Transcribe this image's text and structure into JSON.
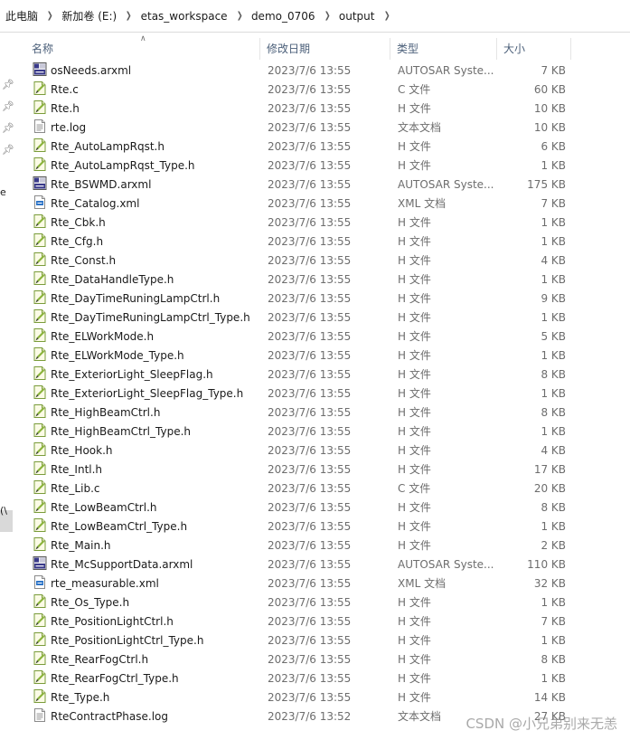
{
  "breadcrumb": [
    "此电脑",
    "新加卷 (E:)",
    "etas_workspace",
    "demo_0706",
    "output"
  ],
  "columns": {
    "name": "名称",
    "date": "修改日期",
    "type": "类型",
    "size": "大小"
  },
  "nav_fragments": [
    "e",
    "(\\"
  ],
  "files": [
    {
      "name": "osNeeds.arxml",
      "date": "2023/7/6 13:55",
      "type": "AUTOSAR Syste...",
      "size": "7 KB",
      "icon": "arxml-file-icon"
    },
    {
      "name": "Rte.c",
      "date": "2023/7/6 13:55",
      "type": "C 文件",
      "size": "60 KB",
      "icon": "source-file-icon"
    },
    {
      "name": "Rte.h",
      "date": "2023/7/6 13:55",
      "type": "H 文件",
      "size": "10 KB",
      "icon": "source-file-icon"
    },
    {
      "name": "rte.log",
      "date": "2023/7/6 13:55",
      "type": "文本文档",
      "size": "10 KB",
      "icon": "text-file-icon"
    },
    {
      "name": "Rte_AutoLampRqst.h",
      "date": "2023/7/6 13:55",
      "type": "H 文件",
      "size": "6 KB",
      "icon": "source-file-icon"
    },
    {
      "name": "Rte_AutoLampRqst_Type.h",
      "date": "2023/7/6 13:55",
      "type": "H 文件",
      "size": "1 KB",
      "icon": "source-file-icon"
    },
    {
      "name": "Rte_BSWMD.arxml",
      "date": "2023/7/6 13:55",
      "type": "AUTOSAR Syste...",
      "size": "175 KB",
      "icon": "arxml-file-icon"
    },
    {
      "name": "Rte_Catalog.xml",
      "date": "2023/7/6 13:55",
      "type": "XML 文档",
      "size": "7 KB",
      "icon": "xml-file-icon"
    },
    {
      "name": "Rte_Cbk.h",
      "date": "2023/7/6 13:55",
      "type": "H 文件",
      "size": "1 KB",
      "icon": "source-file-icon"
    },
    {
      "name": "Rte_Cfg.h",
      "date": "2023/7/6 13:55",
      "type": "H 文件",
      "size": "1 KB",
      "icon": "source-file-icon"
    },
    {
      "name": "Rte_Const.h",
      "date": "2023/7/6 13:55",
      "type": "H 文件",
      "size": "4 KB",
      "icon": "source-file-icon"
    },
    {
      "name": "Rte_DataHandleType.h",
      "date": "2023/7/6 13:55",
      "type": "H 文件",
      "size": "1 KB",
      "icon": "source-file-icon"
    },
    {
      "name": "Rte_DayTimeRuningLampCtrl.h",
      "date": "2023/7/6 13:55",
      "type": "H 文件",
      "size": "9 KB",
      "icon": "source-file-icon"
    },
    {
      "name": "Rte_DayTimeRuningLampCtrl_Type.h",
      "date": "2023/7/6 13:55",
      "type": "H 文件",
      "size": "1 KB",
      "icon": "source-file-icon"
    },
    {
      "name": "Rte_ELWorkMode.h",
      "date": "2023/7/6 13:55",
      "type": "H 文件",
      "size": "5 KB",
      "icon": "source-file-icon"
    },
    {
      "name": "Rte_ELWorkMode_Type.h",
      "date": "2023/7/6 13:55",
      "type": "H 文件",
      "size": "1 KB",
      "icon": "source-file-icon"
    },
    {
      "name": "Rte_ExteriorLight_SleepFlag.h",
      "date": "2023/7/6 13:55",
      "type": "H 文件",
      "size": "8 KB",
      "icon": "source-file-icon"
    },
    {
      "name": "Rte_ExteriorLight_SleepFlag_Type.h",
      "date": "2023/7/6 13:55",
      "type": "H 文件",
      "size": "1 KB",
      "icon": "source-file-icon"
    },
    {
      "name": "Rte_HighBeamCtrl.h",
      "date": "2023/7/6 13:55",
      "type": "H 文件",
      "size": "8 KB",
      "icon": "source-file-icon"
    },
    {
      "name": "Rte_HighBeamCtrl_Type.h",
      "date": "2023/7/6 13:55",
      "type": "H 文件",
      "size": "1 KB",
      "icon": "source-file-icon"
    },
    {
      "name": "Rte_Hook.h",
      "date": "2023/7/6 13:55",
      "type": "H 文件",
      "size": "4 KB",
      "icon": "source-file-icon"
    },
    {
      "name": "Rte_Intl.h",
      "date": "2023/7/6 13:55",
      "type": "H 文件",
      "size": "17 KB",
      "icon": "source-file-icon"
    },
    {
      "name": "Rte_Lib.c",
      "date": "2023/7/6 13:55",
      "type": "C 文件",
      "size": "20 KB",
      "icon": "source-file-icon"
    },
    {
      "name": "Rte_LowBeamCtrl.h",
      "date": "2023/7/6 13:55",
      "type": "H 文件",
      "size": "8 KB",
      "icon": "source-file-icon"
    },
    {
      "name": "Rte_LowBeamCtrl_Type.h",
      "date": "2023/7/6 13:55",
      "type": "H 文件",
      "size": "1 KB",
      "icon": "source-file-icon"
    },
    {
      "name": "Rte_Main.h",
      "date": "2023/7/6 13:55",
      "type": "H 文件",
      "size": "2 KB",
      "icon": "source-file-icon"
    },
    {
      "name": "Rte_McSupportData.arxml",
      "date": "2023/7/6 13:55",
      "type": "AUTOSAR Syste...",
      "size": "110 KB",
      "icon": "arxml-file-icon"
    },
    {
      "name": "rte_measurable.xml",
      "date": "2023/7/6 13:55",
      "type": "XML 文档",
      "size": "32 KB",
      "icon": "xml-file-icon"
    },
    {
      "name": "Rte_Os_Type.h",
      "date": "2023/7/6 13:55",
      "type": "H 文件",
      "size": "1 KB",
      "icon": "source-file-icon"
    },
    {
      "name": "Rte_PositionLightCtrl.h",
      "date": "2023/7/6 13:55",
      "type": "H 文件",
      "size": "7 KB",
      "icon": "source-file-icon"
    },
    {
      "name": "Rte_PositionLightCtrl_Type.h",
      "date": "2023/7/6 13:55",
      "type": "H 文件",
      "size": "1 KB",
      "icon": "source-file-icon"
    },
    {
      "name": "Rte_RearFogCtrl.h",
      "date": "2023/7/6 13:55",
      "type": "H 文件",
      "size": "8 KB",
      "icon": "source-file-icon"
    },
    {
      "name": "Rte_RearFogCtrl_Type.h",
      "date": "2023/7/6 13:55",
      "type": "H 文件",
      "size": "1 KB",
      "icon": "source-file-icon"
    },
    {
      "name": "Rte_Type.h",
      "date": "2023/7/6 13:55",
      "type": "H 文件",
      "size": "14 KB",
      "icon": "source-file-icon"
    },
    {
      "name": "RteContractPhase.log",
      "date": "2023/7/6 13:52",
      "type": "文本文档",
      "size": "27 KB",
      "icon": "text-file-icon"
    }
  ],
  "watermark": "CSDN @小兄弟别来无恙"
}
